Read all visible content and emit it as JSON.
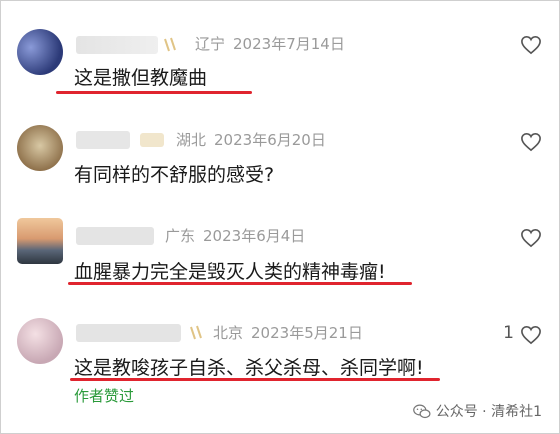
{
  "comments": [
    {
      "location": "辽宁",
      "date": "2023年7月14日",
      "text": "这是撒但教魔曲",
      "likes": ""
    },
    {
      "location": "湖北",
      "date": "2023年6月20日",
      "text": "有同样的不舒服的感受?",
      "likes": ""
    },
    {
      "location": "广东",
      "date": "2023年6月4日",
      "text": "血腥暴力完全是毁灭人类的精神毒瘤!",
      "likes": ""
    },
    {
      "location": "北京",
      "date": "2023年5月21日",
      "text": "这是教唆孩子自杀、杀父杀母、杀同学啊!",
      "likes": "1"
    }
  ],
  "author_liked": "作者赞过",
  "watermark": "公众号 · 清希社1",
  "underline_color": "#e0242e",
  "icons": [
    "heart-outline-icon",
    "wechat-icon"
  ]
}
